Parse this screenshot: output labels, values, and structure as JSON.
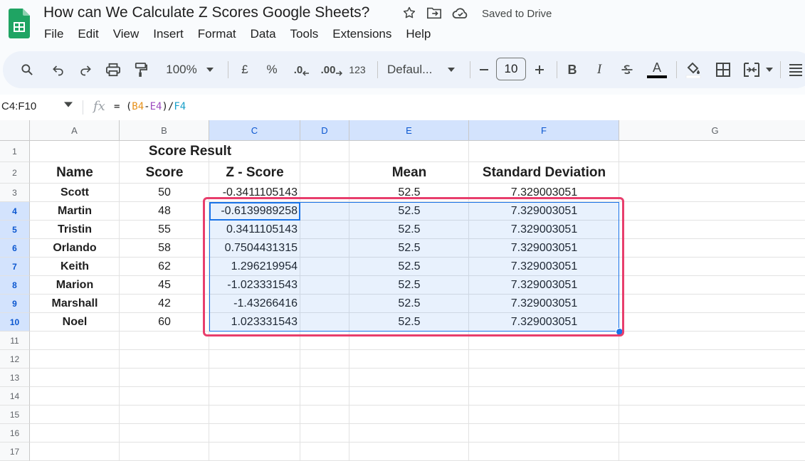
{
  "app": {
    "title": "How can We Calculate Z Scores Google Sheets?",
    "saved_status": "Saved to Drive",
    "colors": {
      "accent": "#1a73e8",
      "highlight": "#e83e6c",
      "logo": "#1fa463"
    }
  },
  "menu": [
    "File",
    "Edit",
    "View",
    "Insert",
    "Format",
    "Data",
    "Tools",
    "Extensions",
    "Help"
  ],
  "toolbar": {
    "zoom": "100%",
    "currency": "£",
    "percent": "%",
    "decrease_decimal": ".0",
    "increase_decimal": ".00",
    "number_format": "123",
    "font": "Defaul...",
    "font_size": "10",
    "bold": "B",
    "italic": "I",
    "text_color": "A"
  },
  "formula_bar": {
    "name_box": "C4:F10",
    "fx": "fx",
    "parts": [
      "= (",
      "B4",
      "-",
      "E4",
      ")/",
      "F4"
    ]
  },
  "sheet": {
    "columns": [
      "A",
      "B",
      "C",
      "D",
      "E",
      "F",
      "G"
    ],
    "rows": [
      "1",
      "2",
      "3",
      "4",
      "5",
      "6",
      "7",
      "8",
      "9",
      "10",
      "11",
      "12",
      "13",
      "14",
      "15",
      "16",
      "17"
    ],
    "title": "Score Result",
    "headers": {
      "name": "Name",
      "score": "Score",
      "zscore": "Z - Score",
      "mean": "Mean",
      "sd": "Standard Deviation"
    },
    "data": [
      {
        "name": "Scott",
        "score": "50",
        "z": "-0.3411105143",
        "mean": "52.5",
        "sd": "7.329003051"
      },
      {
        "name": "Martin",
        "score": "48",
        "z": "-0.6139989258",
        "mean": "52.5",
        "sd": "7.329003051"
      },
      {
        "name": "Tristin",
        "score": "55",
        "z": "0.3411105143",
        "mean": "52.5",
        "sd": "7.329003051"
      },
      {
        "name": "Orlando",
        "score": "58",
        "z": "0.7504431315",
        "mean": "52.5",
        "sd": "7.329003051"
      },
      {
        "name": "Keith",
        "score": "62",
        "z": "1.296219954",
        "mean": "52.5",
        "sd": "7.329003051"
      },
      {
        "name": "Marion",
        "score": "45",
        "z": "-1.023331543",
        "mean": "52.5",
        "sd": "7.329003051"
      },
      {
        "name": "Marshall",
        "score": "42",
        "z": "-1.43266416",
        "mean": "52.5",
        "sd": "7.329003051"
      },
      {
        "name": "Noel",
        "score": "60",
        "z": "1.023331543",
        "mean": "52.5",
        "sd": "7.329003051"
      }
    ]
  }
}
